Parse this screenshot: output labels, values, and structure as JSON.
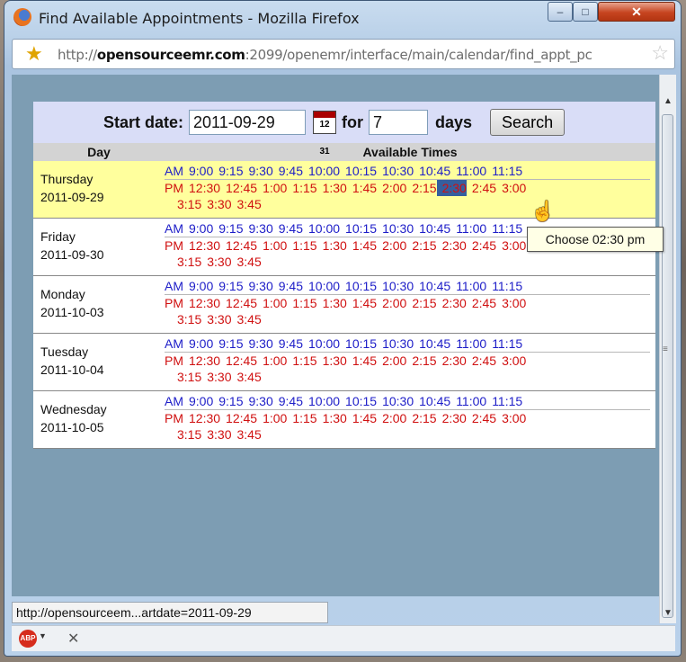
{
  "window": {
    "title": "Find Available Appointments - Mozilla Firefox",
    "minimize": "–",
    "maximize": "□",
    "close": "✕"
  },
  "address": {
    "prefix": "http://",
    "domain": "opensourceemr.com",
    "rest": ":2099/openemr/interface/main/calendar/find_appt_pc"
  },
  "search": {
    "start_label": "Start date:",
    "start_value": "2011-09-29",
    "calendar_icon_text": "12 31",
    "for_label": "for",
    "days_value": "7",
    "days_label": "days",
    "button": "Search"
  },
  "table": {
    "col_day": "Day",
    "col_times": "Available Times",
    "rows": [
      {
        "weekday": "Thursday",
        "date": "2011-09-29"
      },
      {
        "weekday": "Friday",
        "date": "2011-09-30"
      },
      {
        "weekday": "Monday",
        "date": "2011-10-03"
      },
      {
        "weekday": "Tuesday",
        "date": "2011-10-04"
      },
      {
        "weekday": "Wednesday",
        "date": "2011-10-05"
      }
    ],
    "am_label": "AM",
    "pm_label": "PM",
    "am_times": [
      "9:00",
      "9:15",
      "9:30",
      "9:45",
      "10:00",
      "10:15",
      "10:30",
      "10:45",
      "11:00",
      "11:15"
    ],
    "pm_times": [
      "12:30",
      "12:45",
      "1:00",
      "1:15",
      "1:30",
      "1:45",
      "2:00",
      "2:15",
      "2:30",
      "2:45",
      "3:00"
    ],
    "pm_times_2": [
      "3:15",
      "3:30",
      "3:45"
    ],
    "highlighted": "2:30"
  },
  "tooltip": "Choose 02:30 pm",
  "status_bar": "http://opensourceem...artdate=2011-09-29",
  "addon": {
    "abp": "ABP",
    "close": "✕"
  }
}
